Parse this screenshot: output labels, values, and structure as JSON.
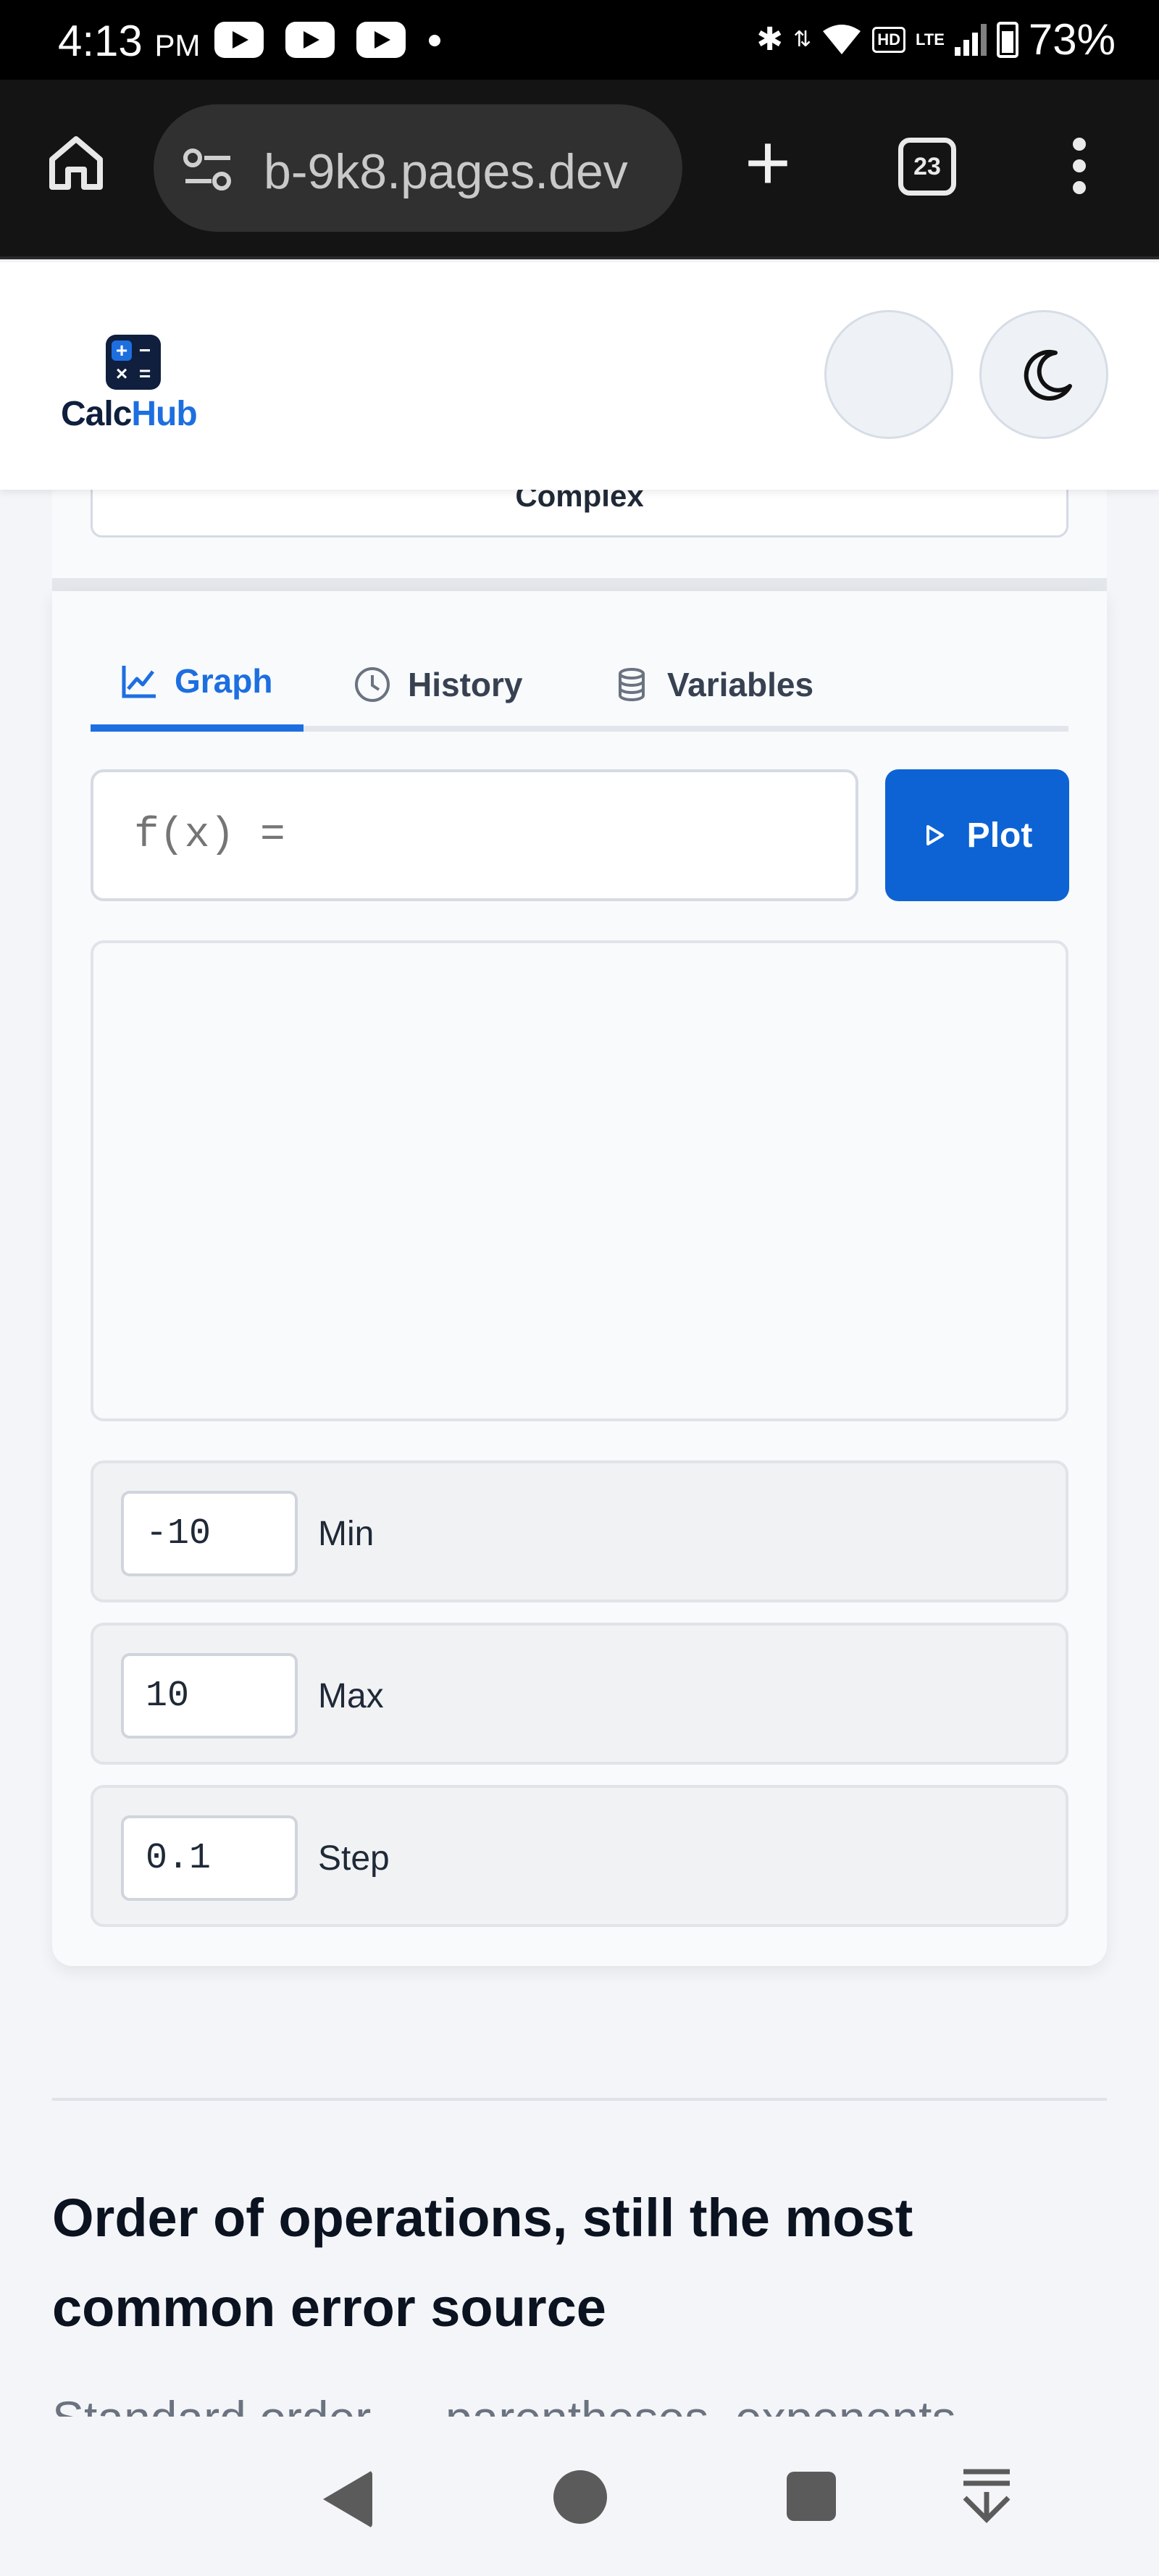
{
  "status_bar": {
    "time": "4:13",
    "ampm": "PM",
    "hd_badge": "HD",
    "network": "LTE",
    "battery": "73%"
  },
  "browser": {
    "url": "b-9k8.pages.dev",
    "tab_count": "23"
  },
  "site": {
    "logo_prefix": "Calc",
    "logo_suffix": "Hub"
  },
  "calculator": {
    "mode_button_label": "Complex",
    "tabs": [
      {
        "label": "Graph",
        "icon": "chart-line-icon",
        "active": true
      },
      {
        "label": "History",
        "icon": "clock-icon",
        "active": false
      },
      {
        "label": "Variables",
        "icon": "database-icon",
        "active": false
      }
    ],
    "function_input": {
      "placeholder": "f(x) =",
      "value": ""
    },
    "plot_button": "Plot",
    "range": {
      "min": {
        "value": "-10",
        "label": "Min"
      },
      "max": {
        "value": "10",
        "label": "Max"
      },
      "step": {
        "value": "0.1",
        "label": "Step"
      }
    }
  },
  "article": {
    "title": "Order of operations, still the most common error source",
    "intro": "Standard order — parentheses, exponents,"
  },
  "colors": {
    "accent": "#1d6fe0",
    "plot_button": "#0d63d4",
    "brand_dark": "#0f1f3d"
  }
}
